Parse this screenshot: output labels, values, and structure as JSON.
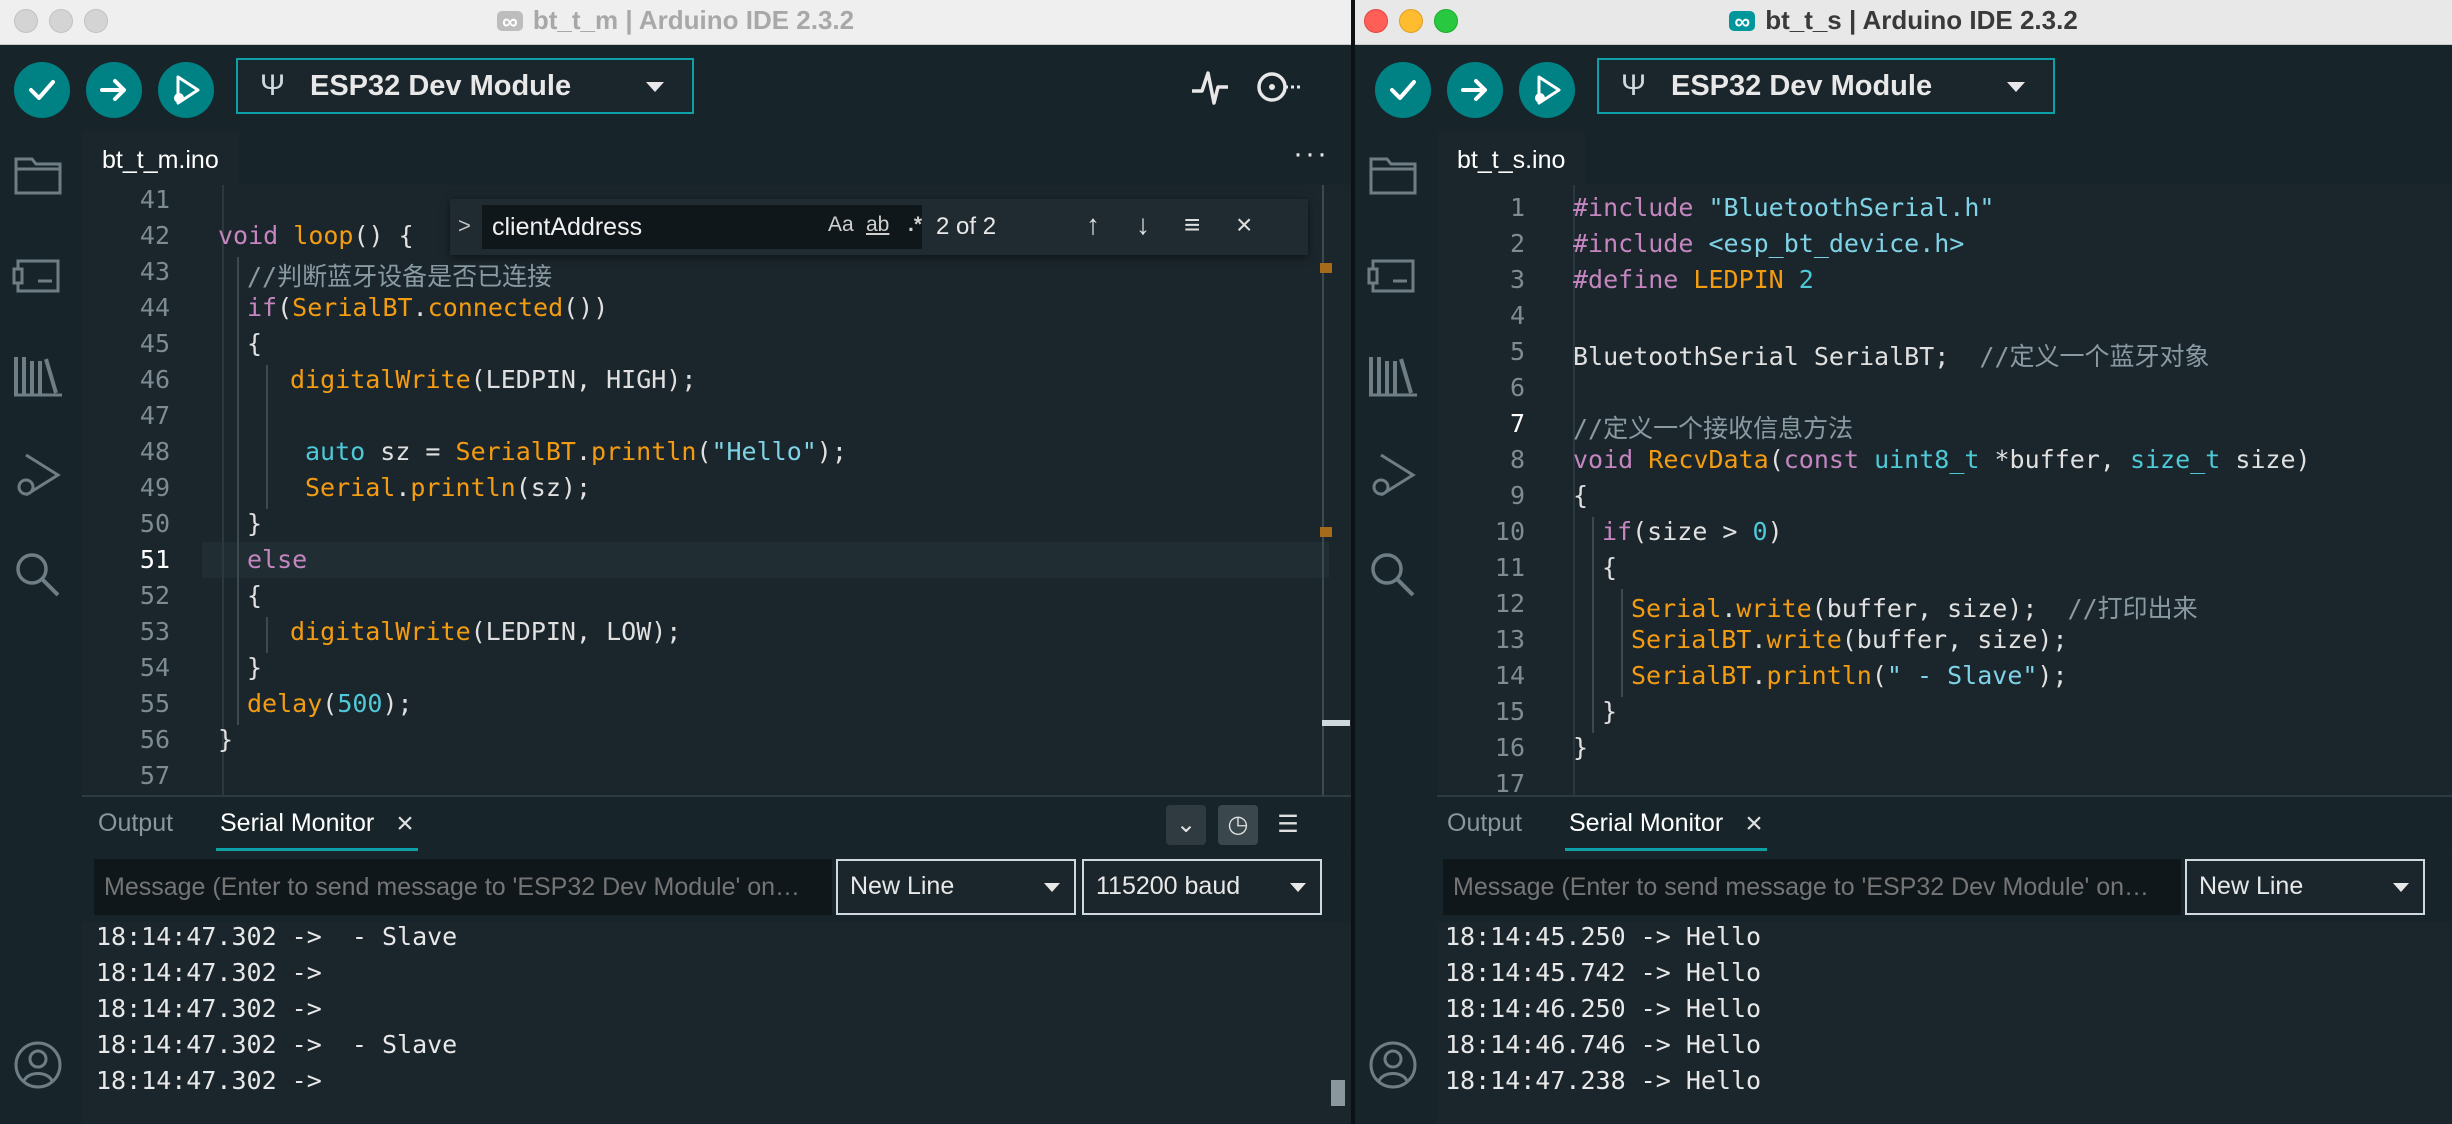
{
  "left": {
    "title": "bt_t_m | Arduino IDE 2.3.2",
    "board": "ESP32 Dev Module",
    "file_tab": "bt_t_m.ino",
    "find": {
      "query": "clientAddress",
      "opt_case": "Aa",
      "opt_word": "ab",
      "opt_regex": ".*",
      "count": "2 of 2"
    },
    "line_numbers": [
      "41",
      "42",
      "43",
      "44",
      "45",
      "46",
      "47",
      "48",
      "49",
      "50",
      "51",
      "52",
      "53",
      "54",
      "55",
      "56",
      "57"
    ],
    "code": {
      "l42_kw": "void",
      "l42_fn": "loop",
      "l42_rest": "() {",
      "l43_cm": "//判断蓝牙设备是否已连接",
      "l44_kw": "if",
      "l44_p1": "(",
      "l44_obj": "SerialBT",
      "l44_dot": ".",
      "l44_fn": "connected",
      "l44_p2": "())",
      "l45": "{",
      "l46_fn": "digitalWrite",
      "l46_rest": "(LEDPIN, HIGH);",
      "l48_ty": "auto",
      "l48_mid": " sz = ",
      "l48_obj": "SerialBT",
      "l48_dot": ".",
      "l48_fn": "println",
      "l48_p1": "(",
      "l48_str": "\"Hello\"",
      "l48_p2": ");",
      "l49_obj": "Serial",
      "l49_dot": ".",
      "l49_fn": "println",
      "l49_rest": "(sz);",
      "l50": "}",
      "l51_kw": "else",
      "l52": "{",
      "l53_fn": "digitalWrite",
      "l53_rest": "(LEDPIN, LOW);",
      "l54": "}",
      "l55_fn": "delay",
      "l55_p1": "(",
      "l55_num": "500",
      "l55_p2": ");",
      "l56": "}"
    },
    "panel_tabs": {
      "output": "Output",
      "serial": "Serial Monitor"
    },
    "message_placeholder": "Message (Enter to send message to 'ESP32 Dev Module' on…",
    "line_ending": "New Line",
    "baud": "115200 baud",
    "serial_lines": [
      "18:14:47.302 ->  - Slave",
      "18:14:47.302 ->",
      "18:14:47.302 ->",
      "18:14:47.302 ->  - Slave",
      "18:14:47.302 ->"
    ]
  },
  "right": {
    "title": "bt_t_s | Arduino IDE 2.3.2",
    "board": "ESP32 Dev Module",
    "file_tab": "bt_t_s.ino",
    "line_numbers": [
      "1",
      "2",
      "3",
      "4",
      "5",
      "6",
      "7",
      "8",
      "9",
      "10",
      "11",
      "12",
      "13",
      "14",
      "15",
      "16",
      "17"
    ],
    "code": {
      "l1_pre": "#include",
      "l1_str": " \"BluetoothSerial.h\"",
      "l2_pre": "#include",
      "l2_str": " <esp_bt_device.h>",
      "l3_pre": "#define",
      "l3_fn": " LEDPIN",
      "l3_num": " 2",
      "l5_id": "BluetoothSerial SerialBT;  ",
      "l5_cm": "//定义一个蓝牙对象",
      "l7_cm": "//定义一个接收信息方法",
      "l8_kw": "void",
      "l8_fn": " RecvData",
      "l8_p1": "(",
      "l8_kw2": "const",
      "l8_ty": " uint8_t",
      "l8_mid": " *buffer, ",
      "l8_ty2": "size_t",
      "l8_end": " size)",
      "l9": "{",
      "l10_kw": "if",
      "l10_mid": "(size > ",
      "l10_num": "0",
      "l10_end": ")",
      "l11": "{",
      "l12_obj": "Serial",
      "l12_dot": ".",
      "l12_fn": "write",
      "l12_rest": "(buffer, size);  ",
      "l12_cm": "//打印出来",
      "l13_obj": "SerialBT",
      "l13_dot": ".",
      "l13_fn": "write",
      "l13_rest": "(buffer, size);",
      "l14_obj": "SerialBT",
      "l14_dot": ".",
      "l14_fn": "println",
      "l14_p1": "(",
      "l14_str": "\" - Slave\"",
      "l14_p2": ");",
      "l15": "}",
      "l16": "}"
    },
    "panel_tabs": {
      "output": "Output",
      "serial": "Serial Monitor"
    },
    "message_placeholder": "Message (Enter to send message to 'ESP32 Dev Module' on…",
    "line_ending": "New Line",
    "serial_lines": [
      "18:14:45.250 -> Hello",
      "18:14:45.742 -> Hello",
      "18:14:46.250 -> Hello",
      "18:14:46.746 -> Hello",
      "18:14:47.238 -> Hello"
    ]
  },
  "icons": [
    "verify-icon",
    "upload-icon",
    "debug-icon",
    "usb-icon",
    "serial-plotter-icon",
    "serial-monitor-icon",
    "folder-icon",
    "board-manager-icon",
    "library-icon",
    "debug-sidebar-icon",
    "search-icon",
    "account-icon",
    "close-icon",
    "autoscroll-icon",
    "timestamp-icon",
    "clear-output-icon"
  ],
  "colors": {
    "accent": "#008184",
    "background": "#1b262c",
    "toolbar": "#17252b"
  }
}
